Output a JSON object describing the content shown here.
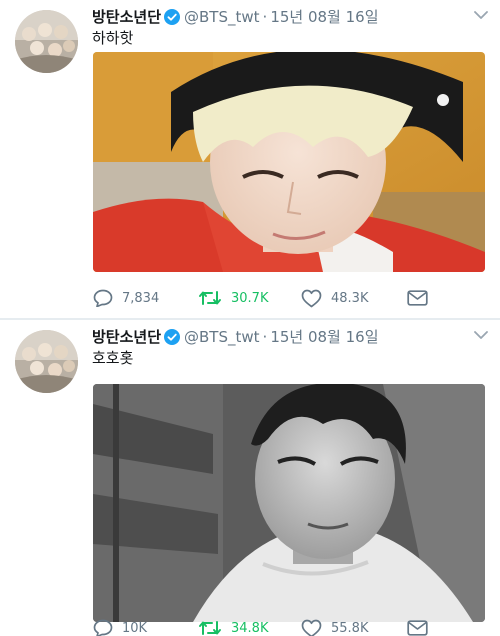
{
  "tweets": [
    {
      "display_name": "방탄소년단",
      "handle": "@BTS_twt",
      "separator": "·",
      "date": "15년 08월 16일",
      "text": "하하핫",
      "replies": "7,834",
      "retweets": "30.7K",
      "likes": "48.3K"
    },
    {
      "display_name": "방탄소년단",
      "handle": "@BTS_twt",
      "separator": "·",
      "date": "15년 08월 16일",
      "text": "호호홋",
      "replies": "10K",
      "retweets": "34.8K",
      "likes": "55.8K"
    }
  ],
  "icons": {
    "verified": "verified-badge-icon",
    "more": "chevron-down-icon",
    "reply": "reply-icon",
    "retweet": "retweet-icon",
    "like": "heart-icon",
    "dm": "direct-message-icon"
  },
  "colors": {
    "verified": "#1da1f2",
    "retweet_active": "#17bf63",
    "muted": "#657786"
  }
}
